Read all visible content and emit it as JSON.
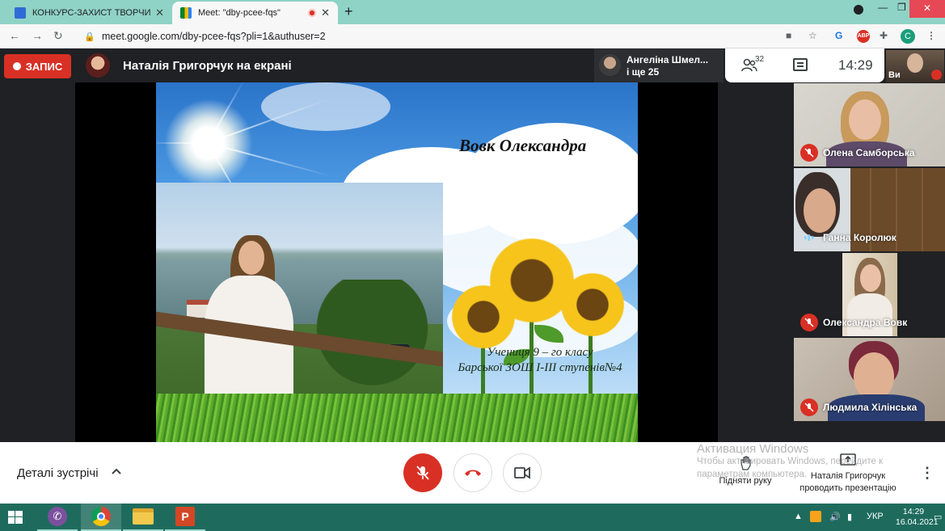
{
  "browser": {
    "tabs": [
      {
        "title": "КОНКУРС-ЗАХИСТ ТВОРЧИХ РОБ",
        "active": false,
        "favicon": "classroom-icon"
      },
      {
        "title": "Meet: \"dby-pcee-fqs\"",
        "active": true,
        "favicon": "meet-icon"
      }
    ],
    "url": "meet.google.com/dby-pcee-fqs?pli=1&authuser=2",
    "profile_initial": "C",
    "abp_label": "ABP"
  },
  "meet": {
    "record_label": "ЗАПИС",
    "presenting_title": "Наталія Григорчук на екрані",
    "participant_summary": {
      "name": "Ангеліна Шмел...",
      "more": "і ще 25"
    },
    "people_count": "32",
    "time": "14:29",
    "self_label": "Ви",
    "colors": {
      "red": "#d93025",
      "bar": "#202124",
      "accent": "#1a73e8"
    }
  },
  "slide": {
    "title": "Вовк Олександра",
    "caption_line1": "Учениця 9 – го класу",
    "caption_line2": "Барської ЗОШ I-III ступенів№4"
  },
  "participants": [
    {
      "name": "Олена Самборська",
      "muted": true
    },
    {
      "name": "Ганна Королюк",
      "muted": false
    },
    {
      "name": "Олександра Вовк",
      "muted": true
    },
    {
      "name": "Людмила Хілінська",
      "muted": true
    }
  ],
  "bottom": {
    "details_label": "Деталі зустрічі",
    "raise_hand_label": "Підняти руку",
    "presenting_line1": "Наталія Григорчук",
    "presenting_line2": "проводить презентацію"
  },
  "windows_watermark": {
    "line1": "Активация Windows",
    "line2": "Чтобы активировать Windows, перейдите к",
    "line3": "параметрам компьютера."
  },
  "taskbar": {
    "language": "УКР",
    "time": "14:29",
    "date": "16.04.2021"
  }
}
